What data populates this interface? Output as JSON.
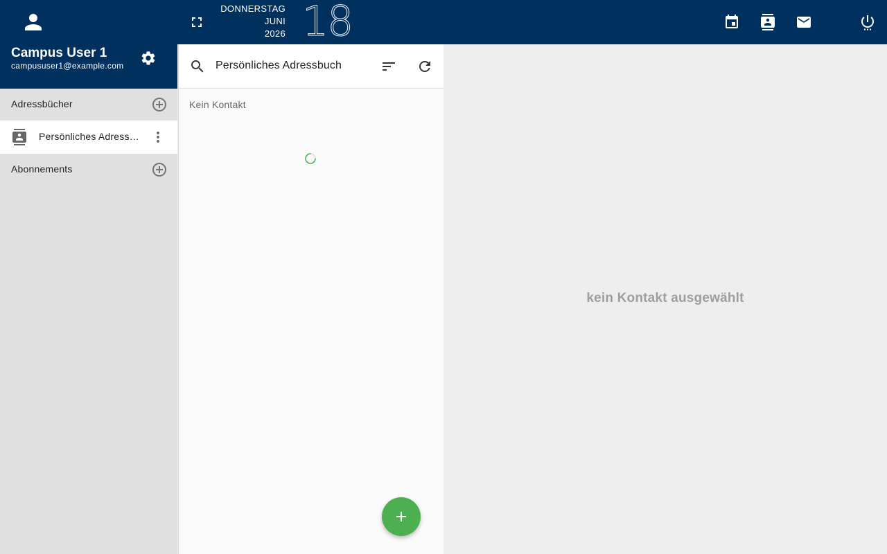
{
  "header": {
    "date": {
      "weekday": "DONNERSTAG",
      "month": "JUNI",
      "year": "2026",
      "day": "18"
    },
    "icons": [
      "fullscreen-icon",
      "calendar-icon",
      "contacts-icon",
      "mail-icon",
      "power-icon"
    ],
    "color": "#00305e"
  },
  "user": {
    "name": "Campus User 1",
    "email": "campususer1@example.com"
  },
  "sidebar": {
    "addressbooks_label": "Adressbücher",
    "addressbooks": [
      {
        "label": "Persönliches Adressbuch",
        "selected": true
      }
    ],
    "subscriptions_label": "Abonnements"
  },
  "list": {
    "title": "Persönliches Adressbuch",
    "empty_text": "Kein Kontakt"
  },
  "detail": {
    "empty_text": "kein Kontakt ausgewählt"
  },
  "colors": {
    "primary": "#00305e",
    "accent": "#4caf50"
  }
}
